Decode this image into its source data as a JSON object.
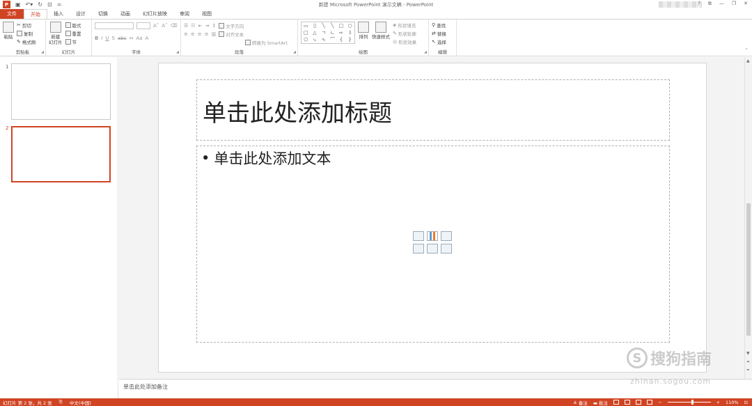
{
  "window": {
    "title": "新建 Microsoft PowerPoint 演示文稿 - PowerPoint",
    "app_logo_letter": "P",
    "controls": [
      "?",
      "⧉",
      "—",
      "❐",
      "✕"
    ]
  },
  "tabs": [
    {
      "label": "文件",
      "kind": "file"
    },
    {
      "label": "开始",
      "kind": "active"
    },
    {
      "label": "插入"
    },
    {
      "label": "设计"
    },
    {
      "label": "切换"
    },
    {
      "label": "动画"
    },
    {
      "label": "幻灯片放映"
    },
    {
      "label": "审阅"
    },
    {
      "label": "视图"
    }
  ],
  "ribbon": {
    "clipboard": {
      "label": "剪贴板",
      "paste": "粘贴",
      "cut": "剪切",
      "copy": "复制",
      "format_painter": "格式刷"
    },
    "slides": {
      "label": "幻灯片",
      "new_slide_line1": "新建",
      "new_slide_line2": "幻灯片",
      "layout": "版式",
      "reset": "重置",
      "section": "节"
    },
    "font": {
      "label": "字体"
    },
    "paragraph": {
      "label": "段落",
      "text_direction": "文字方向",
      "align_text": "对齐文本",
      "smartart": "转换为 SmartArt"
    },
    "drawing": {
      "label": "绘图",
      "arrange": "排列",
      "quick_styles": "快速样式",
      "shape_fill": "形状填充",
      "shape_outline": "形状轮廓",
      "shape_effects": "形状效果"
    },
    "editing": {
      "label": "编辑",
      "find": "查找",
      "replace": "替换",
      "select": "选择"
    }
  },
  "thumbnails": [
    {
      "number": "1",
      "selected": false
    },
    {
      "number": "2",
      "selected": true
    }
  ],
  "slide": {
    "title_placeholder": "单击此处添加标题",
    "body_placeholder": "单击此处添加文本",
    "bullet": "•"
  },
  "notes": {
    "placeholder": "单击此处添加备注"
  },
  "watermark": {
    "brand": "搜狗指南",
    "logo_letter": "S",
    "url": "zhinan.sogou.com"
  },
  "statusbar": {
    "slide_info": "幻灯片 第 2 张，共 2 张",
    "language": "中文(中国)",
    "notes": "备注",
    "comments": "批注",
    "zoom": "110%"
  },
  "colors": {
    "accent": "#d04423"
  }
}
